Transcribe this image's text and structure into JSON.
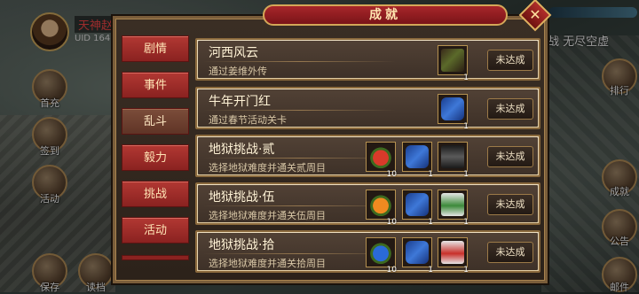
{
  "player": {
    "name": "天神赵",
    "uid": "UID 164"
  },
  "side_left": [
    "首充",
    "签到",
    "活动",
    "保存",
    "读档"
  ],
  "side_right": [
    "排行",
    "成就",
    "公告",
    "邮件"
  ],
  "right_text": "战 无尽空虚",
  "dialog": {
    "title": "成就",
    "close_symbol": "✕"
  },
  "tabs": [
    {
      "label": "剧情",
      "active": false
    },
    {
      "label": "事件",
      "active": false
    },
    {
      "label": "乱斗",
      "active": true
    },
    {
      "label": "毅力",
      "active": false
    },
    {
      "label": "挑战",
      "active": false
    },
    {
      "label": "活动",
      "active": false
    }
  ],
  "achievements": [
    {
      "title": "河西风云",
      "desc": "通过姜维外传",
      "status": "未达成",
      "rewards": [
        {
          "icon": "weapon-icon",
          "count": "1"
        }
      ]
    },
    {
      "title": "牛年开门红",
      "desc": "通过春节活动关卡",
      "status": "未达成",
      "rewards": [
        {
          "icon": "ticket-icon",
          "count": "1"
        }
      ]
    },
    {
      "title": "地狱挑战·贰",
      "desc": "选择地狱难度并通关贰周目",
      "status": "未达成",
      "rewards": [
        {
          "icon": "red-fruit-icon",
          "count": "10"
        },
        {
          "icon": "ticket-icon",
          "count": "1"
        },
        {
          "icon": "monster-icon",
          "count": "1"
        }
      ]
    },
    {
      "title": "地狱挑战·伍",
      "desc": "选择地狱难度并通关伍周目",
      "status": "未达成",
      "rewards": [
        {
          "icon": "orange-fruit-icon",
          "count": "10"
        },
        {
          "icon": "ticket-icon",
          "count": "1"
        },
        {
          "icon": "green-hero-icon",
          "count": "1"
        }
      ]
    },
    {
      "title": "地狱挑战·拾",
      "desc": "选择地狱难度并通关拾周目",
      "status": "未达成",
      "rewards": [
        {
          "icon": "blue-fruit-icon",
          "count": "10"
        },
        {
          "icon": "ticket-icon",
          "count": "1"
        },
        {
          "icon": "red-hero-icon",
          "count": "1"
        }
      ]
    }
  ]
}
